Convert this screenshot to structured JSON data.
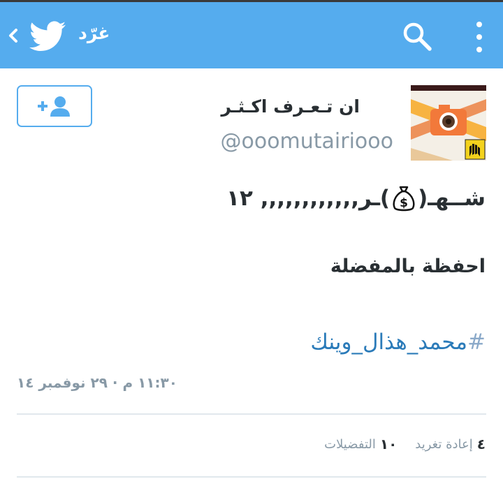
{
  "header": {
    "title": "غرّد",
    "icons": [
      "chevron-left-icon",
      "twitter-bird-icon",
      "search-icon",
      "more-vertical-icon"
    ],
    "colors": {
      "bar": "#55acee",
      "text": "#ffffff"
    }
  },
  "user": {
    "display_name": "ان تـعـرف اكـثـر",
    "handle": "@ooomutairiooo",
    "follow_icon": "add-user-icon"
  },
  "tweet": {
    "line1_part_a": "شــهـ(",
    "line1_part_b": ")ـر,,,,,,,,,,,, ١٢",
    "line2": "احفظة بالمفضلة",
    "hashtag_symbol": "#",
    "hashtag_text": "محمد_هذال_وينك",
    "timestamp": "١١:٣٠ م · ٢٩ نوفمبر ١٤"
  },
  "stats": {
    "retweets_count": "٤",
    "retweets_label": "إعادة تغريد",
    "favorites_count": "١٠",
    "favorites_label": "التفضيلات"
  },
  "colors": {
    "link": "#2b7bb9",
    "muted": "#8899a6",
    "divider": "#e1e8ed"
  }
}
